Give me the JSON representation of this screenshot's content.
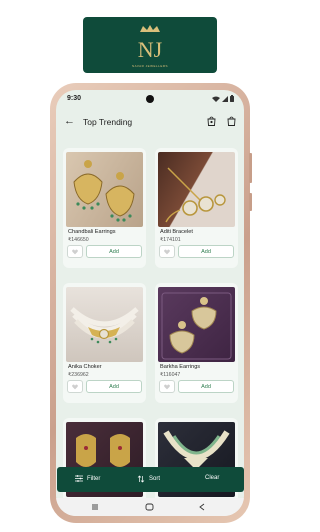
{
  "brand": {
    "logo_letters": "NJ",
    "logo_subtext": "NAVAR JEWELLERS"
  },
  "status_bar": {
    "time": "9:30"
  },
  "header": {
    "title": "Top Trending",
    "back_icon": "arrow-left-icon",
    "icons": [
      "shopping-bag-icon",
      "shopping-bag-icon"
    ]
  },
  "products": [
    {
      "name": "Chandbali Earrings",
      "price": "₹146650",
      "add_label": "Add"
    },
    {
      "name": "Aditi Bracelet",
      "price": "₹174101",
      "add_label": "Add"
    },
    {
      "name": "Anika Choker",
      "price": "₹236962",
      "add_label": "Add"
    },
    {
      "name": "Barkha Earrings",
      "price": "₹116047",
      "add_label": "Add"
    },
    {
      "name": "",
      "price": "",
      "add_label": ""
    },
    {
      "name": "",
      "price": "",
      "add_label": ""
    }
  ],
  "bottom_bar": {
    "filter_label": "Filter",
    "sort_label": "Sort",
    "clear_label": "Clear"
  },
  "colors": {
    "brand_green": "#0f4b3a",
    "gold": "#d9bf7a",
    "add_text": "#2e7d4f"
  }
}
